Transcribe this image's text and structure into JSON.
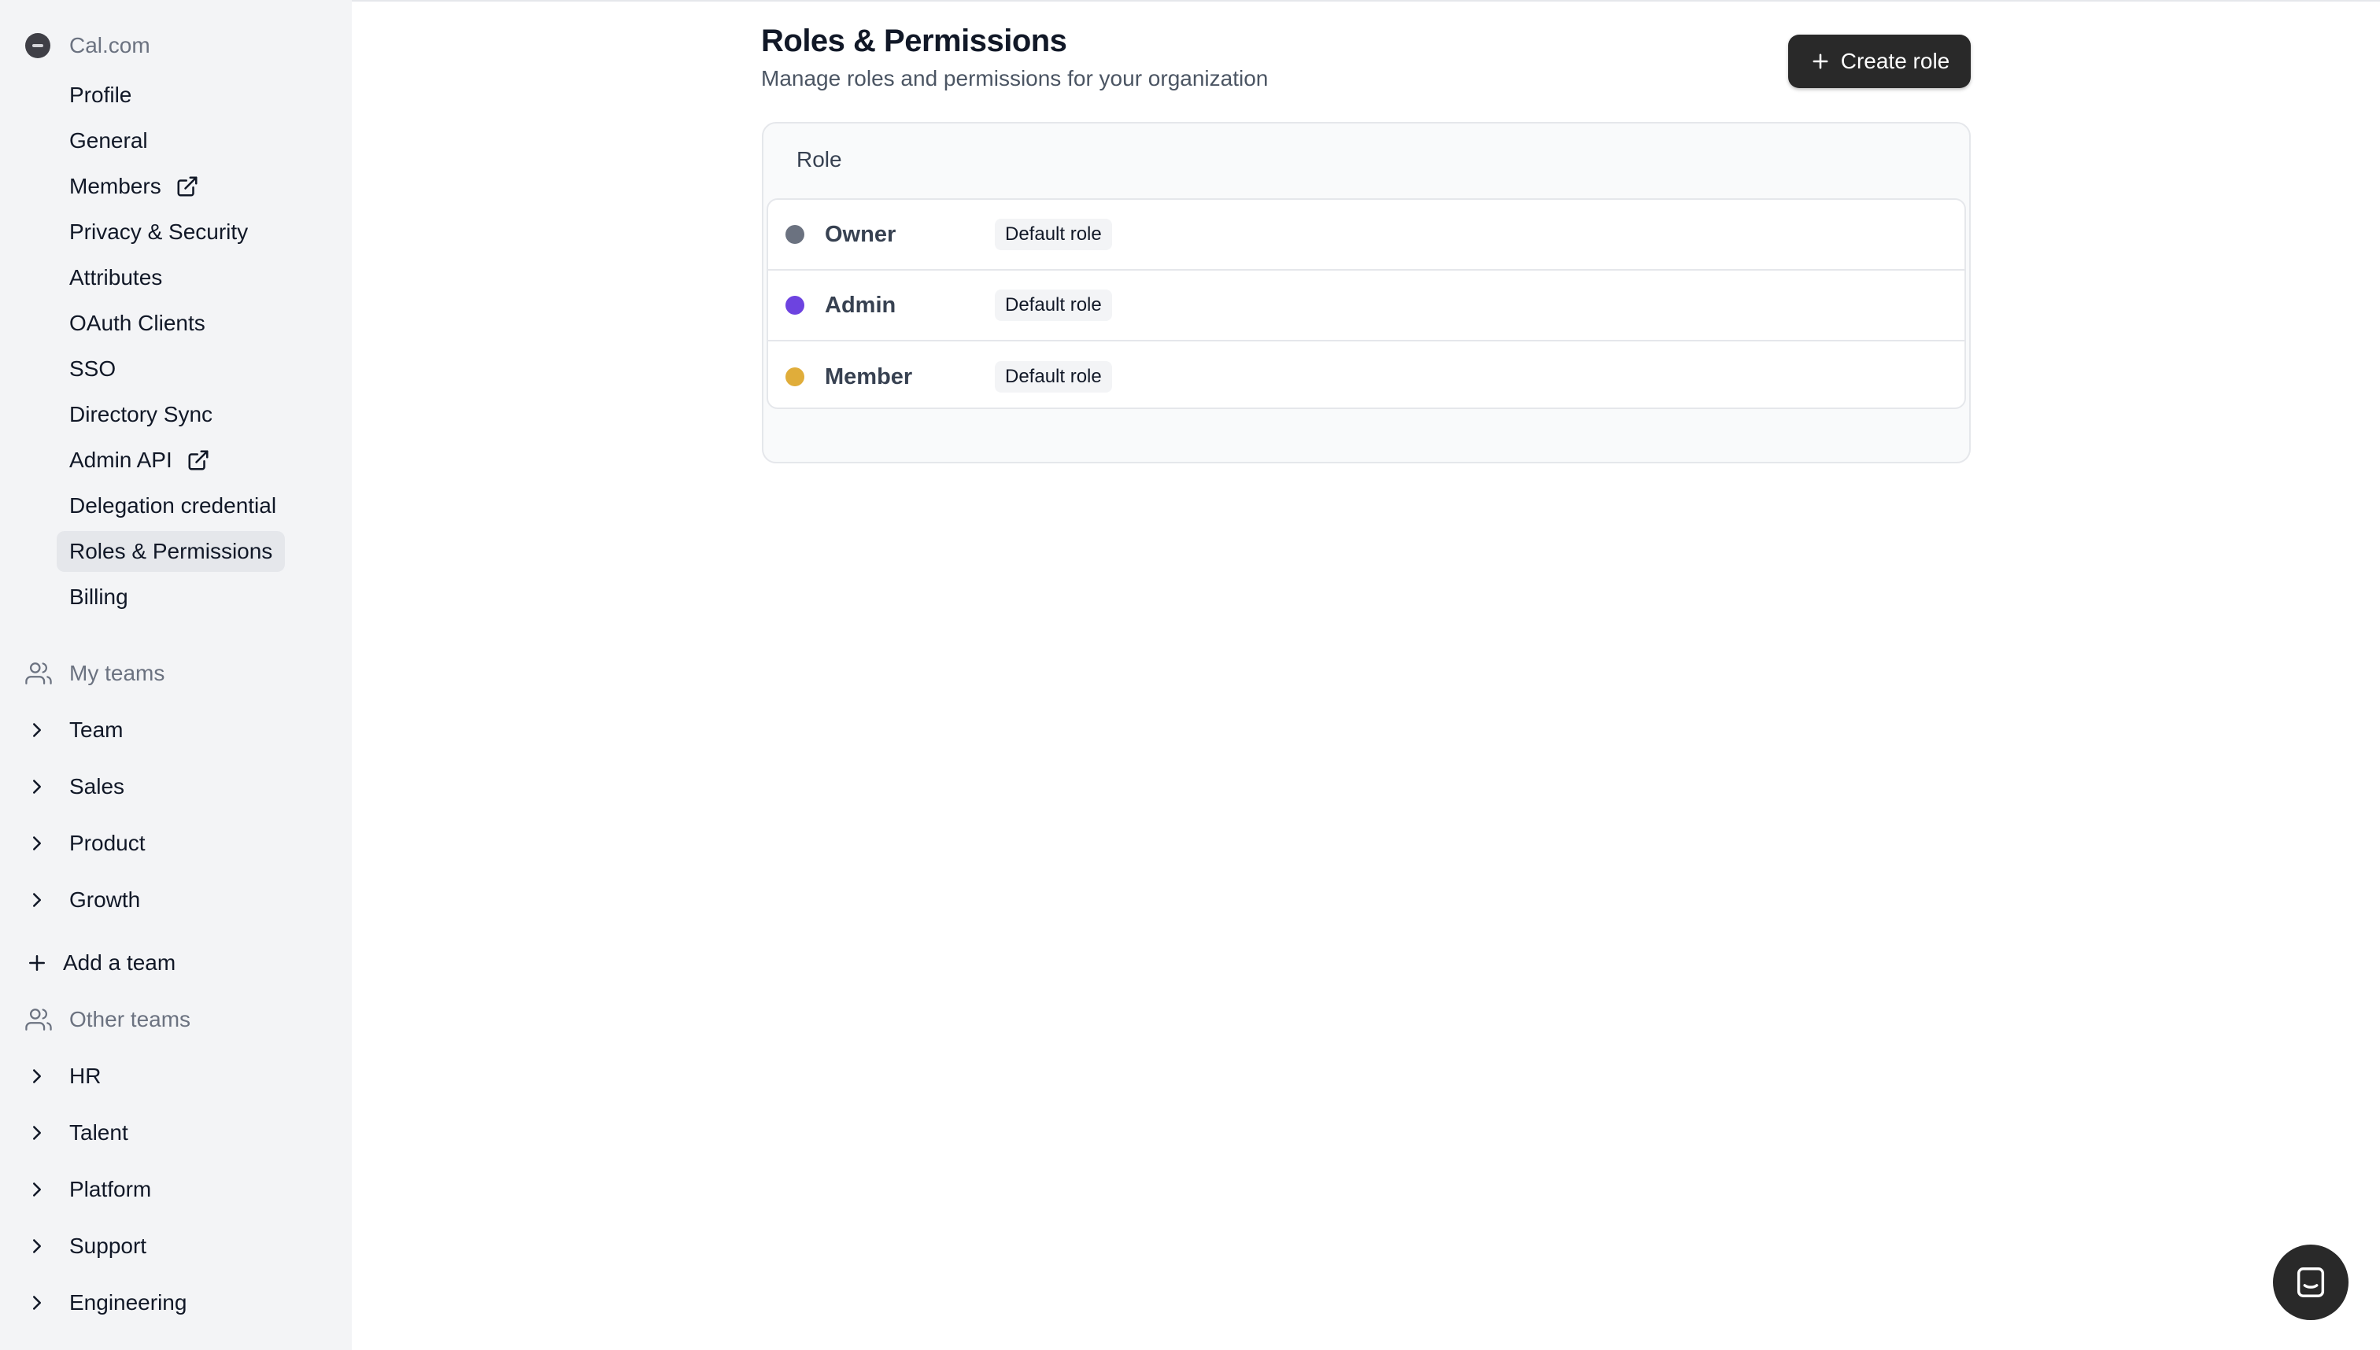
{
  "sidebar": {
    "org_name": "Cal.com",
    "items": [
      {
        "label": "Profile"
      },
      {
        "label": "General"
      },
      {
        "label": "Members"
      },
      {
        "label": "Privacy & Security"
      },
      {
        "label": "Attributes"
      },
      {
        "label": "OAuth Clients"
      },
      {
        "label": "SSO"
      },
      {
        "label": "Directory Sync"
      },
      {
        "label": "Admin API"
      },
      {
        "label": "Delegation credential"
      },
      {
        "label": "Roles & Permissions"
      },
      {
        "label": "Billing"
      }
    ],
    "active_item": "Roles & Permissions",
    "my_teams_label": "My teams",
    "my_teams": [
      "Team",
      "Sales",
      "Product",
      "Growth"
    ],
    "add_team_label": "Add a team",
    "other_teams_label": "Other teams",
    "other_teams": [
      "HR",
      "Talent",
      "Platform",
      "Support",
      "Engineering"
    ]
  },
  "main": {
    "title": "Roles & Permissions",
    "subtitle": "Manage roles and permissions for your organization",
    "create_button_label": "Create role",
    "table_header": "Role",
    "roles": [
      {
        "name": "Owner",
        "badge": "Default role",
        "color": "#6b7280"
      },
      {
        "name": "Admin",
        "badge": "Default role",
        "color": "#6d43e0"
      },
      {
        "name": "Member",
        "badge": "Default role",
        "color": "#e0ad3a"
      }
    ]
  }
}
